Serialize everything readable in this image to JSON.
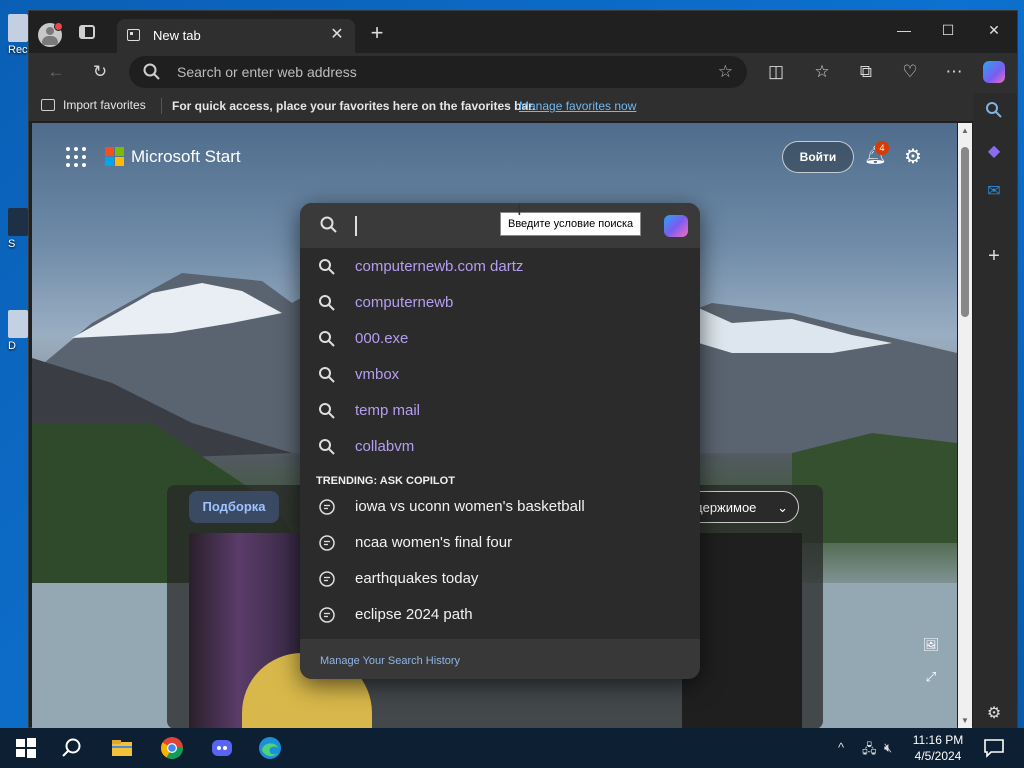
{
  "desktop": {
    "icons": [
      {
        "label": "Rec"
      },
      {
        "label": "S"
      },
      {
        "label": "D"
      }
    ]
  },
  "browser": {
    "tab": {
      "title": "New tab",
      "close": "✕"
    },
    "new_tab": "+",
    "window": {
      "minimize": "—",
      "maximize": "☐",
      "close": "✕"
    },
    "address": {
      "placeholder": "Search or enter web address"
    },
    "favorites_bar": {
      "import": "Import favorites",
      "quick_access": "For quick access, place your favorites here on the favorites bar.",
      "manage": "Manage favorites now"
    }
  },
  "ms_start": {
    "brand": "Microsoft Start",
    "sign_in": "Войти",
    "notifications": "4",
    "feed_tab": "Подборка",
    "content_dropdown": "держимое"
  },
  "search_dropdown": {
    "tooltip": "Введите условие поиска",
    "history": [
      "computernewb.com dartz",
      "computernewb",
      "000.exe",
      "vmbox",
      "temp mail",
      "collabvm"
    ],
    "trending_heading": "TRENDING: ASK COPILOT",
    "trending": [
      "iowa vs uconn women's basketball",
      "ncaa women's final four",
      "earthquakes today",
      "eclipse 2024 path"
    ],
    "footer": "Manage Your Search History"
  },
  "taskbar": {
    "time": "11:16 PM",
    "date": "4/5/2024"
  },
  "colors": {
    "accent": "#6fb8f0",
    "history_text": "#b49ef0",
    "badge": "#d83b01"
  }
}
